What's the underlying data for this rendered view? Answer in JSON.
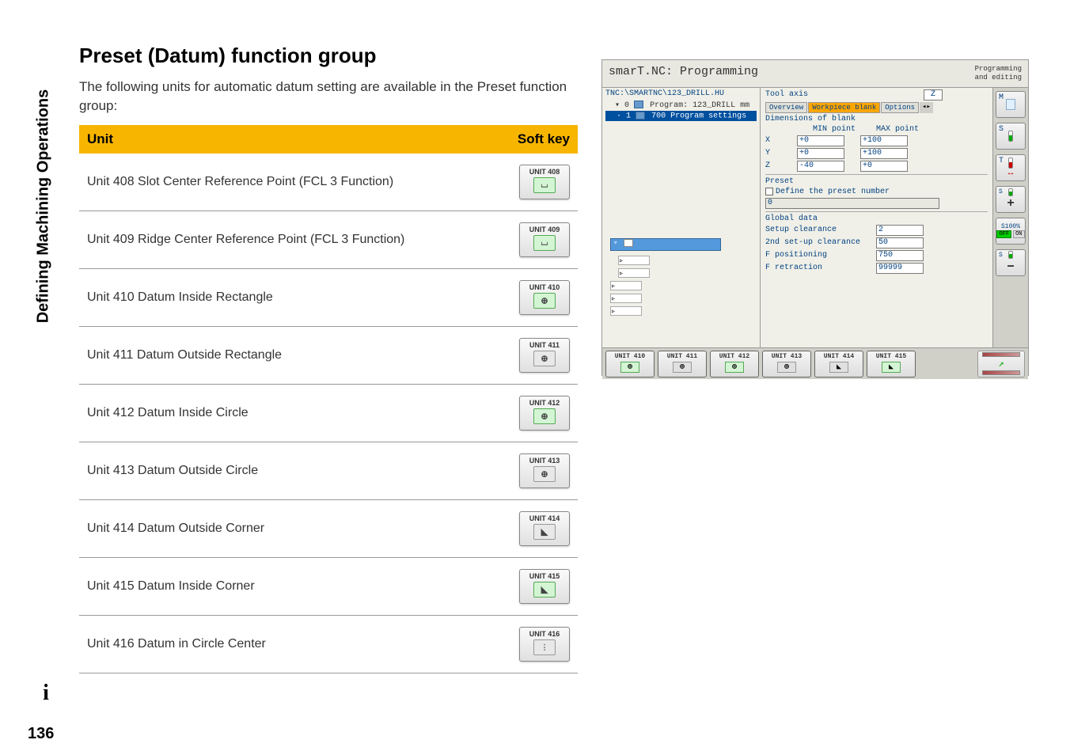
{
  "sidebar": {
    "label": "Defining Machining Operations"
  },
  "page": {
    "title": "Preset (Datum) function group",
    "intro": "The following units for automatic datum setting are available in the Preset function group:",
    "number": "136",
    "info_icon": "i"
  },
  "table": {
    "headers": {
      "unit": "Unit",
      "softkey": "Soft key"
    },
    "rows": [
      {
        "desc": "Unit 408 Slot Center Reference Point (FCL 3 Function)",
        "sk": "UNIT 408",
        "iconClass": "slot"
      },
      {
        "desc": "Unit 409 Ridge Center Reference Point (FCL 3 Function)",
        "sk": "UNIT 409",
        "iconClass": "slot"
      },
      {
        "desc": "Unit 410 Datum Inside Rectangle",
        "sk": "UNIT 410",
        "iconClass": ""
      },
      {
        "desc": "Unit 411 Datum Outside Rectangle",
        "sk": "UNIT 411",
        "iconClass": "gray"
      },
      {
        "desc": "Unit 412 Datum Inside Circle",
        "sk": "UNIT 412",
        "iconClass": ""
      },
      {
        "desc": "Unit 413 Datum Outside Circle",
        "sk": "UNIT 413",
        "iconClass": "gray"
      },
      {
        "desc": "Unit 414 Datum Outside Corner",
        "sk": "UNIT 414",
        "iconClass": "gray corner"
      },
      {
        "desc": "Unit 415 Datum Inside Corner",
        "sk": "UNIT 415",
        "iconClass": "corner"
      },
      {
        "desc": "Unit 416 Datum in Circle Center",
        "sk": "UNIT 416",
        "iconClass": "gray dots"
      }
    ]
  },
  "screenshot": {
    "header_left": "smarT.NC: Programming",
    "header_right_1": "Programming",
    "header_right_2": "and editing",
    "tree": {
      "path": "TNC:\\SMARTNC\\123_DRILL.HU",
      "item0_num": "0",
      "item0_text": "Program: 123_DRILL mm",
      "item1_num": "1",
      "item1_text": "700 Program settings"
    },
    "form": {
      "tool_axis_label": "Tool axis",
      "tool_axis_value": "Z",
      "tabs": {
        "overview": "Overview",
        "blank": "Workpiece blank",
        "options": "Options"
      },
      "dims_label": "Dimensions of blank",
      "min_label": "MIN point",
      "max_label": "MAX point",
      "x_label": "X",
      "x_min": "+0",
      "x_max": "+100",
      "y_label": "Y",
      "y_min": "+0",
      "y_max": "+100",
      "z_label": "Z",
      "z_min": "-40",
      "z_max": "+0",
      "preset_label": "Preset",
      "define_preset": "Define the preset number",
      "preset_value": "0",
      "global_label": "Global data",
      "setup_label": "Setup clearance",
      "setup_val": "2",
      "second_label": "2nd set-up clearance",
      "second_val": "50",
      "fpos_label": "F positioning",
      "fpos_val": "750",
      "fret_label": "F retraction",
      "fret_val": "99999"
    },
    "toolbar": {
      "m": "M",
      "s": "S",
      "t": "T",
      "s_small": "S",
      "s100": "S100%",
      "off": "OFF",
      "on": "ON"
    },
    "footer": {
      "btns": [
        {
          "label": "UNIT 410",
          "iconClass": ""
        },
        {
          "label": "UNIT 411",
          "iconClass": "gray"
        },
        {
          "label": "UNIT 412",
          "iconClass": ""
        },
        {
          "label": "UNIT 413",
          "iconClass": "gray"
        },
        {
          "label": "UNIT 414",
          "iconClass": "gray corner"
        },
        {
          "label": "UNIT 415",
          "iconClass": "corner"
        }
      ]
    }
  }
}
